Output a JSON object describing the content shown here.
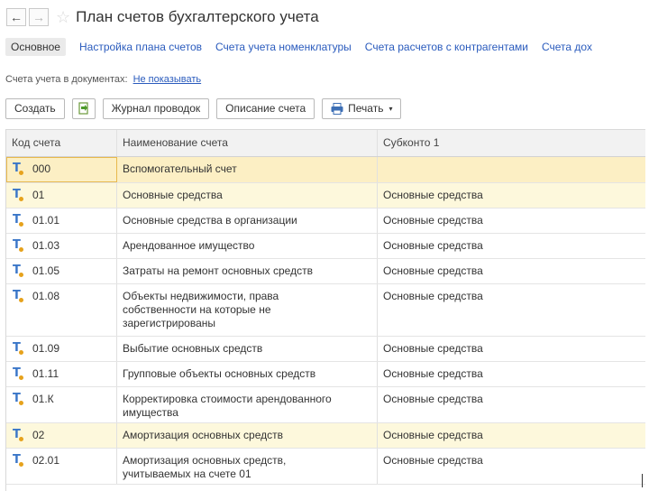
{
  "window": {
    "title": "План счетов бухгалтерского учета",
    "back_glyph": "←",
    "forward_glyph": "→",
    "favorite_glyph": "☆"
  },
  "tabs": {
    "active": "Основное",
    "links": [
      "Настройка плана счетов",
      "Счета учета номенклатуры",
      "Счета расчетов с контрагентами",
      "Счета дох"
    ]
  },
  "doc_accounts": {
    "label": "Счета учета в документах:",
    "link": "Не показывать"
  },
  "toolbar": {
    "create_label": "Создать",
    "copy_icon": "document-copy-icon",
    "journal_label": "Журнал проводок",
    "description_label": "Описание счета",
    "print_label": "Печать",
    "print_icon": "printer-icon",
    "dropdown_glyph": "▾"
  },
  "table": {
    "columns": [
      "Код счета",
      "Наименование счета",
      "Субконто 1"
    ],
    "rows": [
      {
        "code": "000",
        "name": "Вспомогательный счет",
        "sub1": ""
      },
      {
        "code": "01",
        "name": "Основные средства",
        "sub1": "Основные средства"
      },
      {
        "code": "01.01",
        "name": "Основные средства в организации",
        "sub1": "Основные средства"
      },
      {
        "code": "01.03",
        "name": "Арендованное имущество",
        "sub1": "Основные средства"
      },
      {
        "code": "01.05",
        "name": "Затраты на ремонт основных средств",
        "sub1": "Основные средства"
      },
      {
        "code": "01.08",
        "name": "Объекты недвижимости, права\nсобственности на которые не\nзарегистрированы",
        "sub1": "Основные средства"
      },
      {
        "code": "01.09",
        "name": "Выбытие основных средств",
        "sub1": "Основные средства"
      },
      {
        "code": "01.11",
        "name": "Групповые объекты основных средств",
        "sub1": "Основные средства"
      },
      {
        "code": "01.К",
        "name": "Корректировка стоимости арендованного\nимущества",
        "sub1": "Основные средства"
      },
      {
        "code": "02",
        "name": "Амортизация основных средств",
        "sub1": "Основные средства"
      },
      {
        "code": "02.01",
        "name": "Амортизация основных средств,\nучитываемых на счете 01",
        "sub1": "Основные средства"
      }
    ]
  },
  "colors": {
    "link": "#2a5bbd",
    "row_group_highlight": "#fdf8dc",
    "row_selected": "#fcefc4",
    "account_icon": "#3a76c8"
  }
}
